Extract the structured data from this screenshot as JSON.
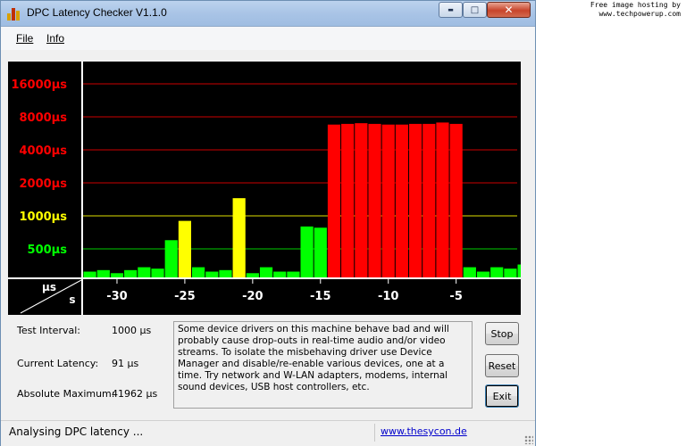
{
  "watermark": {
    "line1": "Free image hosting by",
    "line2": "www.techpowerup.com"
  },
  "window": {
    "title": "DPC Latency Checker V1.1.0",
    "controls": {
      "minimize": "▬",
      "maximize": "□",
      "close": "✕"
    }
  },
  "menu": {
    "file": "File",
    "info": "Info"
  },
  "chart_data": {
    "type": "bar",
    "title": "",
    "xlabel": "s",
    "ylabel": "µs",
    "y_scale": "log",
    "y_tick_labels": [
      "500µs",
      "1000µs",
      "2000µs",
      "4000µs",
      "8000µs",
      "16000µs"
    ],
    "y_ticks": [
      500,
      1000,
      2000,
      4000,
      8000,
      16000
    ],
    "x_tick_labels": [
      "-30",
      "-25",
      "-20",
      "-15",
      "-10",
      "-5"
    ],
    "x_ticks": [
      -30,
      -25,
      -20,
      -15,
      -10,
      -5
    ],
    "x_range": [
      -32.5,
      -0.5
    ],
    "grid": true,
    "background": "#000000",
    "threshold_colors": {
      "green": "#00ff00",
      "yellow": "#ffff00",
      "red": "#ff0000"
    },
    "grid_line_colors": {
      "500": "#00cc00",
      "1000": "#e0e000",
      "2000": "#cc0000",
      "4000": "#cc0000",
      "8000": "#cc0000",
      "16000": "#cc0000"
    },
    "tick_label_colors": {
      "500": "#00ff00",
      "1000": "#ffff00",
      "2000": "#ff0000",
      "4000": "#ff0000",
      "8000": "#ff0000",
      "16000": "#ff0000"
    },
    "bars": [
      {
        "x": -32,
        "value": 310,
        "color": "green"
      },
      {
        "x": -31,
        "value": 320,
        "color": "green"
      },
      {
        "x": -30,
        "value": 300,
        "color": "green"
      },
      {
        "x": -29,
        "value": 320,
        "color": "green"
      },
      {
        "x": -28,
        "value": 340,
        "color": "green"
      },
      {
        "x": -27,
        "value": 330,
        "color": "green"
      },
      {
        "x": -26,
        "value": 600,
        "color": "green"
      },
      {
        "x": -25,
        "value": 900,
        "color": "yellow"
      },
      {
        "x": -24,
        "value": 340,
        "color": "green"
      },
      {
        "x": -23,
        "value": 310,
        "color": "green"
      },
      {
        "x": -22,
        "value": 320,
        "color": "green"
      },
      {
        "x": -21,
        "value": 1450,
        "color": "yellow"
      },
      {
        "x": -20,
        "value": 300,
        "color": "green"
      },
      {
        "x": -19,
        "value": 340,
        "color": "green"
      },
      {
        "x": -18,
        "value": 310,
        "color": "green"
      },
      {
        "x": -17,
        "value": 310,
        "color": "green"
      },
      {
        "x": -16,
        "value": 800,
        "color": "green"
      },
      {
        "x": -15,
        "value": 780,
        "color": "green"
      },
      {
        "x": -14,
        "value": 6800,
        "color": "red"
      },
      {
        "x": -13,
        "value": 6900,
        "color": "red"
      },
      {
        "x": -12,
        "value": 7000,
        "color": "red"
      },
      {
        "x": -11,
        "value": 6900,
        "color": "red"
      },
      {
        "x": -10,
        "value": 6800,
        "color": "red"
      },
      {
        "x": -9,
        "value": 6800,
        "color": "red"
      },
      {
        "x": -8,
        "value": 6900,
        "color": "red"
      },
      {
        "x": -7,
        "value": 6900,
        "color": "red"
      },
      {
        "x": -6,
        "value": 7100,
        "color": "red"
      },
      {
        "x": -5,
        "value": 6900,
        "color": "red"
      },
      {
        "x": -4,
        "value": 340,
        "color": "green"
      },
      {
        "x": -3,
        "value": 310,
        "color": "green"
      },
      {
        "x": -2,
        "value": 340,
        "color": "green"
      },
      {
        "x": -1,
        "value": 330,
        "color": "green"
      },
      {
        "x": 0,
        "value": 360,
        "color": "green"
      }
    ]
  },
  "info": {
    "test_interval_label": "Test Interval:",
    "test_interval_value": "1000 µs",
    "current_latency_label": "Current Latency:",
    "current_latency_value": "91 µs",
    "absolute_maximum_label": "Absolute Maximum:",
    "absolute_maximum_value": "41962 µs"
  },
  "message": "Some device drivers on this machine behave bad and will probably cause drop-outs in real-time audio and/or video streams. To isolate the misbehaving driver use Device Manager and disable/re-enable various devices, one at a time. Try network and W-LAN adapters, modems, internal sound devices, USB host controllers, etc.",
  "buttons": {
    "stop": "Stop",
    "reset": "Reset",
    "exit": "Exit"
  },
  "status": {
    "text": "Analysing DPC latency ...",
    "link": "www.thesycon.de"
  }
}
